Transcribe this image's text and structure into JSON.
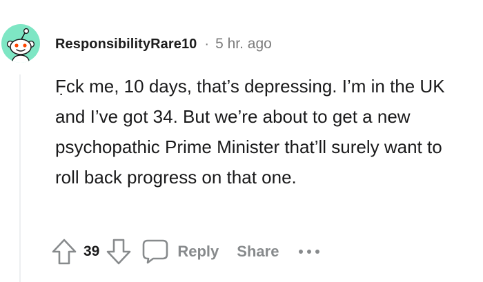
{
  "comment": {
    "username": "ResponsibilityRare10",
    "separator": "·",
    "time": "5 hr. ago",
    "body": "F̣ck me, 10 days, that’s depressing. I’m in the UK and I’ve got 34. But we’re about to get a new psychopathic Prime Minister that’ll surely want to roll back progress on that one.",
    "avatar_color": "#7ee6c4"
  },
  "actions": {
    "upvote_icon": "arrow-up-outline-icon",
    "vote_count": "39",
    "downvote_icon": "arrow-down-outline-icon",
    "reply_icon": "speech-bubble-icon",
    "reply_label": "Reply",
    "share_label": "Share",
    "more_icon": "ellipsis-icon",
    "muted_color": "#878a8c"
  }
}
